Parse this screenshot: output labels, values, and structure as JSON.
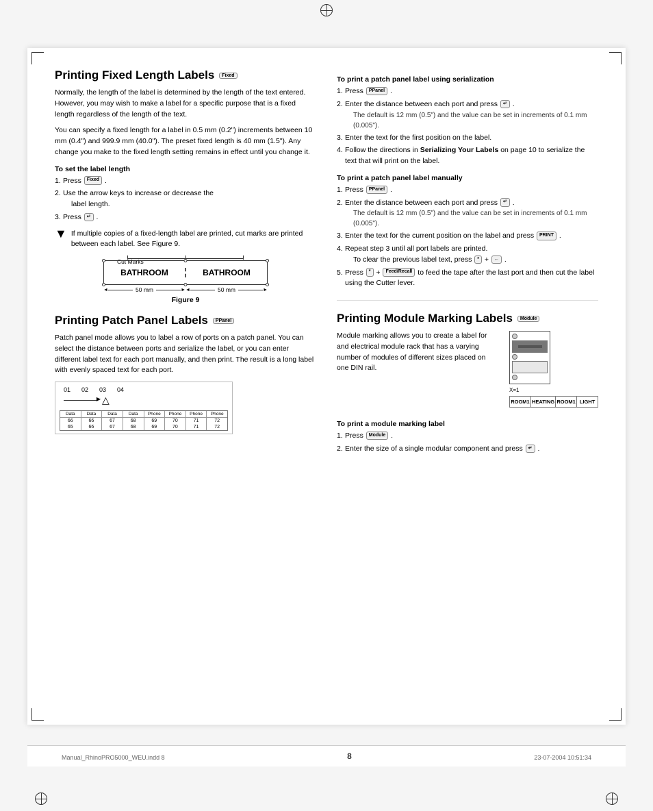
{
  "page": {
    "number": "8",
    "footer_filename": "Manual_RhinoPRO5000_WEU.indd   8",
    "footer_date": "23-07-2004   10:51:34"
  },
  "left_col": {
    "section1": {
      "title": "Printing Fixed Length Labels",
      "title_badge": "Fixed",
      "body1": "Normally, the length of the label is determined by the length of the text entered. However, you may wish to make a label for a specific purpose that is a fixed length regardless of the length of the text.",
      "body2": "You can specify a fixed length for a label in 0.5 mm (0.2\") increments between 10 mm (0.4\") and 999.9 mm (40.0\"). The preset fixed length is 40 mm (1.5\"). Any change you make to the fixed length setting remains in effect until you change it.",
      "subsection_title": "To set the label length",
      "steps": [
        {
          "num": "1.",
          "text": "Press",
          "btn": "Fixed",
          "text2": "."
        },
        {
          "num": "2.",
          "text": "Use the arrow keys to increase or decrease the label length."
        },
        {
          "num": "3.",
          "text": "Press",
          "btn": "↵",
          "text2": "."
        }
      ],
      "note": "If multiple copies of a fixed-length label are printed, cut marks are printed between each label. See Figure 9.",
      "figure_caption": "Figure 9",
      "cut_marks_label": "Cut Marks",
      "label_text_left": "BATHROOM",
      "label_text_right": "BATHROOM",
      "dim_label_left": "50 mm",
      "dim_label_right": "50 mm"
    },
    "section2": {
      "title": "Printing Patch Panel Labels",
      "title_badge": "PPanel",
      "body": "Patch panel mode allows you to label a row of ports on a patch panel. You can select the distance between ports and serialize the label, or you can enter different label text for each port manually, and then print. The result is a long label with evenly spaced text for each port.",
      "patch_numbers": [
        "01",
        "02",
        "03",
        "04"
      ],
      "patch_header": [
        "Data",
        "Data",
        "Data",
        "Data",
        "Phone",
        "Phone",
        "Phone",
        "Phone"
      ],
      "patch_header_nums": [
        "66",
        "66",
        "67",
        "68",
        "69",
        "70",
        "71",
        "72"
      ],
      "patch_data": [
        "65",
        "66",
        "67",
        "68",
        "69",
        "70",
        "71",
        "72"
      ]
    }
  },
  "right_col": {
    "section1": {
      "title_serial": "To print a patch panel label using serialization",
      "steps_serial": [
        {
          "num": "1.",
          "text": "Press",
          "btn": "PPanel",
          "text2": "."
        },
        {
          "num": "2.",
          "text": "Enter the distance between each port and press",
          "btn": "↵",
          "text2": ".",
          "note": "The default is 12 mm (0.5\") and the value can be set in increments of 0.1 mm (0.005\")."
        },
        {
          "num": "3.",
          "text": "Enter the text for the first position on the label."
        },
        {
          "num": "4.",
          "text": "Follow the directions in",
          "bold": "Serializing Your Labels",
          "text2": " on page 10 to serialize the text that will print on the label."
        }
      ],
      "title_manual": "To print a patch panel label manually",
      "steps_manual": [
        {
          "num": "1.",
          "text": "Press",
          "btn": "PPanel",
          "text2": "."
        },
        {
          "num": "2.",
          "text": "Enter the distance between each port and press",
          "btn": "↵",
          "text2": ".",
          "note": "The default is 12 mm (0.5\") and the value can be set in increments of 0.1 mm (0.005\")."
        },
        {
          "num": "3.",
          "text": "Enter the text for the current position on the label and press",
          "btn": "PRINT",
          "text2": "."
        },
        {
          "num": "4.",
          "text": "Repeat step 3 until all port labels are printed.",
          "sub_note": "To clear the previous label text, press",
          "sub_btn1": "*",
          "sub_btn2": "←",
          "sub_note2": "."
        },
        {
          "num": "5.",
          "text": "Press",
          "btn1": "*",
          "btn2": "Feed/Recall",
          "text2": " to feed the tape after the last port and then cut the label using the Cutter lever."
        }
      ]
    },
    "section2": {
      "title": "Printing Module Marking Labels",
      "title_badge": "Module",
      "body": "Module marking allows you to create a label for and electrical module rack that has a varying number of modules of different sizes placed on one DIN rail.",
      "module_x_label": "X=1",
      "module_labels": [
        "ROOM1",
        "HEATING",
        "ROOM1",
        "LIGHT"
      ],
      "subsection_title": "To print a module marking label",
      "steps": [
        {
          "num": "1.",
          "text": "Press",
          "btn": "Module",
          "text2": "."
        },
        {
          "num": "2.",
          "text": "Enter the size of a single modular component and press",
          "btn": "↵",
          "text2": "."
        }
      ]
    }
  }
}
